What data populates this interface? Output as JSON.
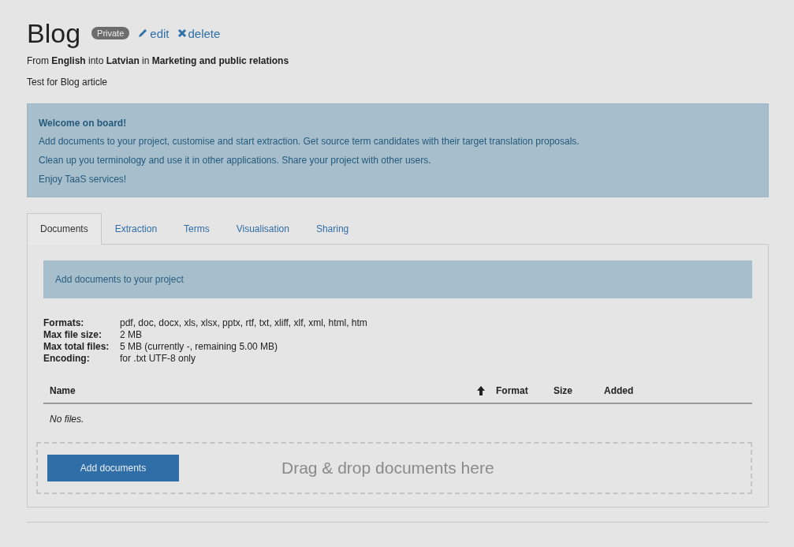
{
  "project": {
    "title": "Blog",
    "badge": "Private",
    "actions": [
      {
        "kind": "edit",
        "label": "edit"
      },
      {
        "kind": "delete",
        "label": "delete"
      }
    ],
    "subtitle": "From **English** into **Latvian** in **Marketing and public relations**",
    "description": "Test for Blog article"
  },
  "welcome": {
    "title": "Welcome on board!",
    "lines": [
      "Add documents to your project, customise and start extraction. Get source term candidates with their target translation proposals.",
      "Clean up you terminology and use it in other applications. Share your project with other users.",
      "Enjoy TaaS services!"
    ]
  },
  "tabs": [
    {
      "label": "Documents",
      "selected": true
    },
    {
      "label": "Extraction",
      "selected": false
    },
    {
      "label": "Terms",
      "selected": false
    },
    {
      "label": "Visualisation",
      "selected": false
    },
    {
      "label": "Sharing",
      "selected": false
    }
  ],
  "documents": {
    "notice": "Add documents to your project",
    "info": [
      {
        "label": "Formats:",
        "value": "pdf, doc, docx, xls, xlsx, pptx, rtf, txt, xliff, xlf, xml, html, htm"
      },
      {
        "label": "Max file size:",
        "value": "2 MB"
      },
      {
        "label": "Max total files:",
        "value": "5 MB (currently -, remaining 5.00 MB)"
      },
      {
        "label": "Encoding:",
        "value": "for .txt UTF-8 only"
      }
    ],
    "table": {
      "columns": [
        {
          "label": "Name",
          "sorted": true
        },
        {
          "label": "Format",
          "sorted": false
        },
        {
          "label": "Size",
          "sorted": false
        },
        {
          "label": "Added",
          "sorted": false
        }
      ],
      "empty": "No files."
    },
    "add_button": "Add documents",
    "drop_hint": "Drag & drop documents here"
  }
}
